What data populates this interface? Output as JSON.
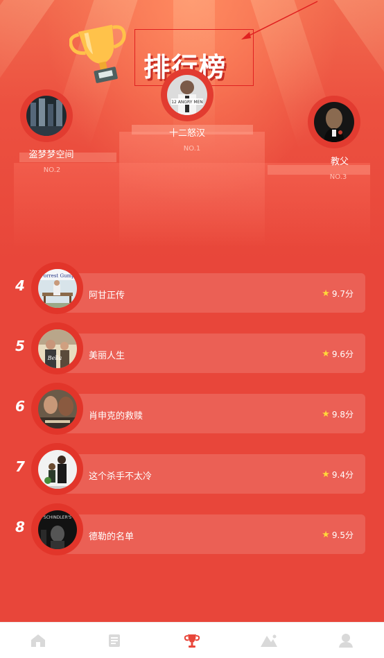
{
  "header": {
    "title": "排行榜"
  },
  "colors": {
    "background": "#e8463a",
    "accent_gold": "#ffc24a",
    "star": "#ffd83a",
    "annotation_red": "#e02020"
  },
  "podium": [
    {
      "name": "十二怒汉",
      "rank_label": "NO.1",
      "poster_text": "12 ANGRY MEN"
    },
    {
      "name": "盗梦梦空间",
      "rank_label": "NO.2"
    },
    {
      "name": "教父",
      "rank_label": "NO.3"
    }
  ],
  "ranking": [
    {
      "rank": "4",
      "name": "阿甘正传",
      "score": "9.7分",
      "poster_text": "Forrest Gump"
    },
    {
      "rank": "5",
      "name": "美丽人生",
      "score": "9.6分",
      "poster_text": "Bella"
    },
    {
      "rank": "6",
      "name": "肖申克的救赎",
      "score": "9.8分"
    },
    {
      "rank": "7",
      "name": "这个杀手不太冷",
      "score": "9.4分"
    },
    {
      "rank": "8",
      "name": "德勒的名单",
      "score": "9.5分",
      "poster_text": "SCHINDLER'S"
    }
  ],
  "tabbar": [
    {
      "icon": "home-icon",
      "active": false
    },
    {
      "icon": "list-icon",
      "active": false
    },
    {
      "icon": "trophy-icon",
      "active": true
    },
    {
      "icon": "mountain-icon",
      "active": false
    },
    {
      "icon": "user-icon",
      "active": false
    }
  ]
}
